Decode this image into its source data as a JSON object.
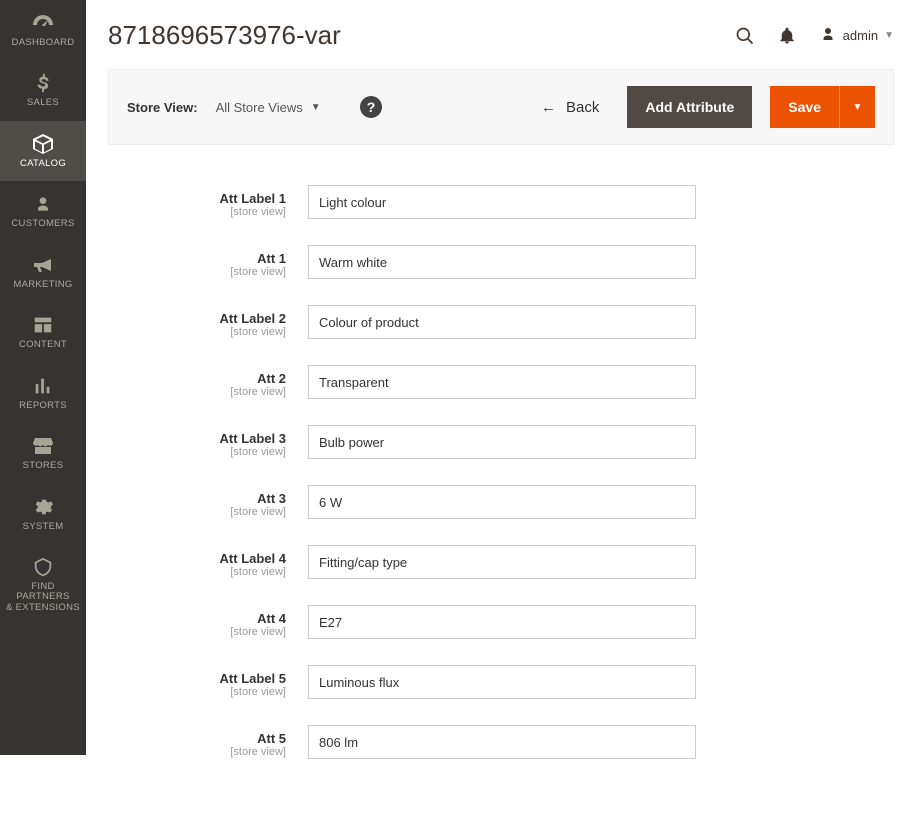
{
  "sidebar": {
    "items": [
      {
        "label": "DASHBOARD"
      },
      {
        "label": "SALES"
      },
      {
        "label": "CATALOG"
      },
      {
        "label": "CUSTOMERS"
      },
      {
        "label": "MARKETING"
      },
      {
        "label": "CONTENT"
      },
      {
        "label": "REPORTS"
      },
      {
        "label": "STORES"
      },
      {
        "label": "SYSTEM"
      },
      {
        "label": "FIND PARTNERS\n& EXTENSIONS"
      }
    ]
  },
  "header": {
    "title": "8718696573976-var",
    "user": "admin"
  },
  "toolbar": {
    "store_view_label": "Store View:",
    "store_view_value": "All Store Views",
    "back_label": "Back",
    "add_attribute_label": "Add Attribute",
    "save_label": "Save"
  },
  "form": {
    "scope_label": "[store view]",
    "fields": [
      {
        "label": "Att Label 1",
        "value": "Light colour"
      },
      {
        "label": "Att 1",
        "value": "Warm white"
      },
      {
        "label": "Att Label 2",
        "value": "Colour of product"
      },
      {
        "label": "Att 2",
        "value": "Transparent"
      },
      {
        "label": "Att Label 3",
        "value": "Bulb power"
      },
      {
        "label": "Att 3",
        "value": "6 W"
      },
      {
        "label": "Att Label 4",
        "value": "Fitting/cap type"
      },
      {
        "label": "Att 4",
        "value": "E27"
      },
      {
        "label": "Att Label 5",
        "value": "Luminous flux"
      },
      {
        "label": "Att 5",
        "value": "806 lm"
      }
    ]
  }
}
